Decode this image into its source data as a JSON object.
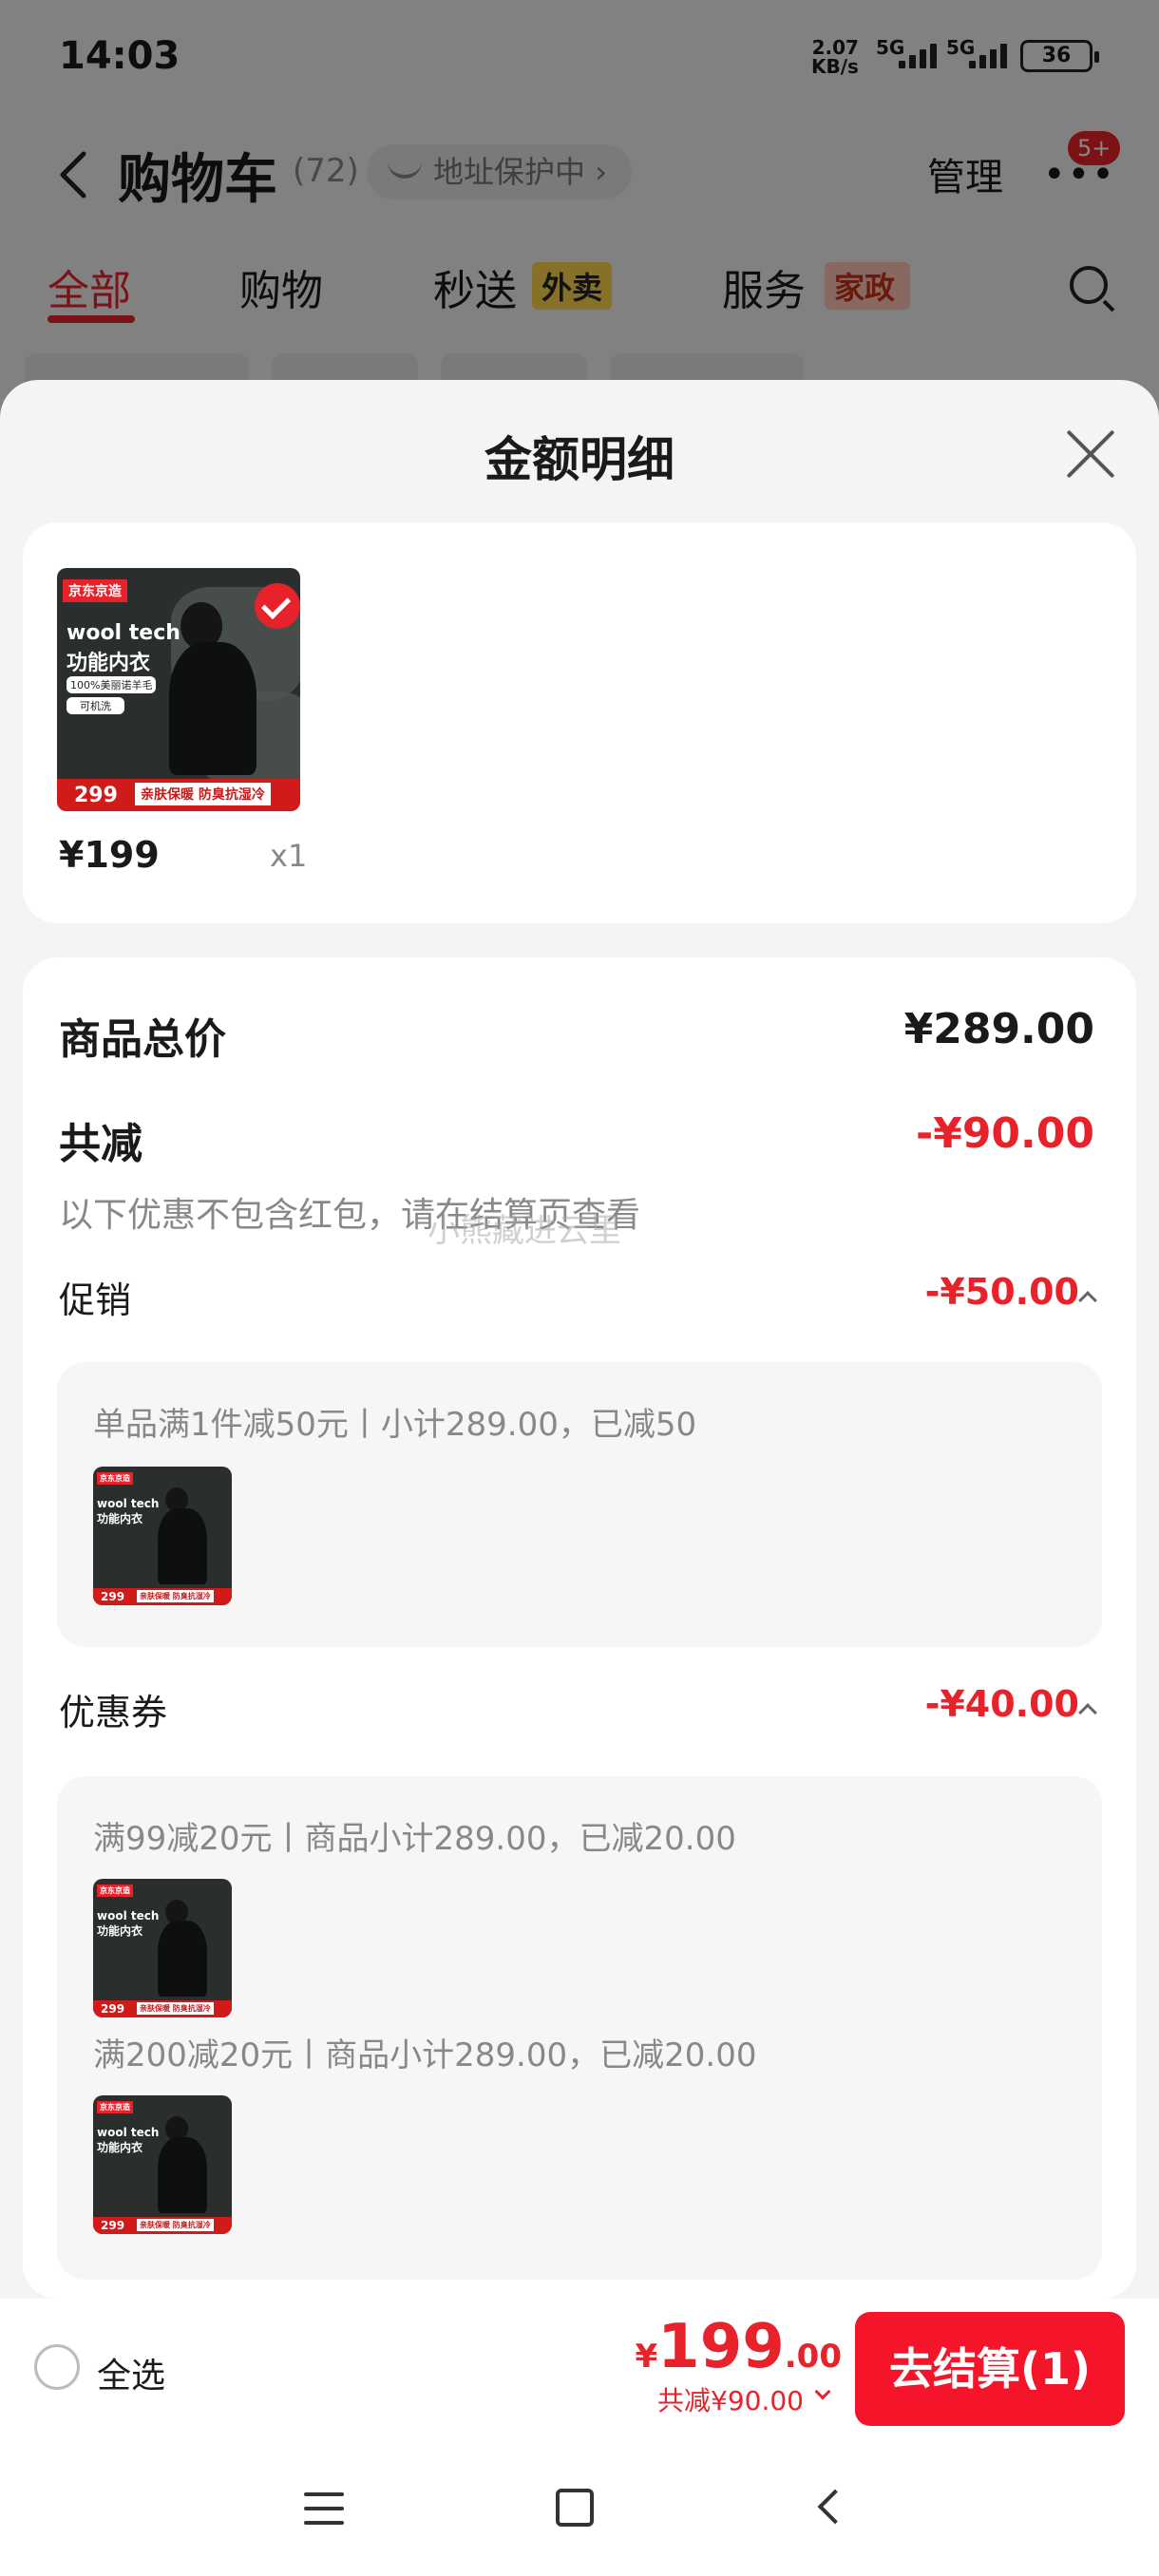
{
  "status_bar": {
    "time": "14:03",
    "speed_value": "2.07",
    "speed_unit": "KB/s",
    "network1": "5G",
    "network2": "5G",
    "battery": "36"
  },
  "header": {
    "title": "购物车",
    "count": "(72)",
    "address_protect": "地址保护中",
    "manage": "管理",
    "more_badge": "5+"
  },
  "tabs": {
    "all": "全部",
    "shopping": "购物",
    "express": "秒送",
    "express_tag": "外卖",
    "service": "服务",
    "service_tag": "家政"
  },
  "sheet": {
    "title": "金额明细",
    "item": {
      "price": "¥199",
      "qty": "x1"
    },
    "thumb": {
      "brand": "京东京造",
      "line1": "wool tech",
      "line2": "功能内衣",
      "pill1": "100%美丽诺羊毛",
      "pill2": "可机洗",
      "price": "299",
      "slogan": "亲肤保暖 防臭抗湿冷"
    },
    "total_label": "商品总价",
    "total_value": "¥289.00",
    "discount_label": "共减",
    "discount_value": "-¥90.00",
    "note": "以下优惠不包含红包，请在结算页查看",
    "promo_label": "促销",
    "promo_value": "-¥50.00",
    "promo_detail": "单品满1件减50元丨小计289.00，已减50",
    "coupon_label": "优惠券",
    "coupon_value": "-¥40.00",
    "coupon_detail1": "满99减20元丨商品小计289.00，已减20.00",
    "coupon_detail2": "满200减20元丨商品小计289.00，已减20.00",
    "watermark": "小熊藏进云里"
  },
  "bottom_bar": {
    "select_all": "全选",
    "yen": "¥",
    "price_int": "199",
    "price_dec": ".00",
    "discount": "共减¥90.00",
    "checkout": "去结算(1)"
  }
}
